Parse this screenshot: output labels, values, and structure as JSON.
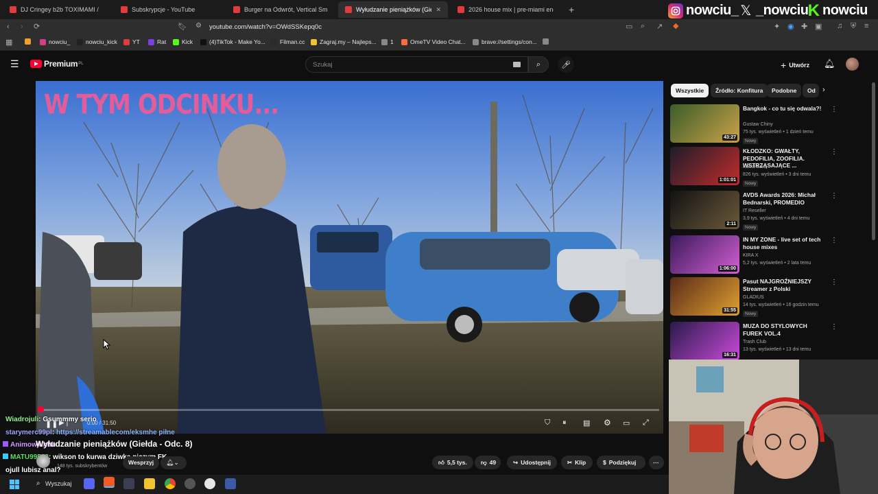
{
  "browser": {
    "tabs": [
      {
        "label": "DJ Cringey b2b TOXIMAMI // Sexpre",
        "color": "#e23b3b"
      },
      {
        "label": "Subskrypcje - YouTube",
        "color": "#e23b3b"
      },
      {
        "label": "Burger na Odwrót, Vertical Smash Bu",
        "color": "#e23b3b"
      },
      {
        "label": "Wyłudzanie pieniążków (Gie",
        "color": "#e23b3b",
        "active": true
      },
      {
        "label": "2026 house mix | pre-miami energy",
        "color": "#e23b3b"
      }
    ],
    "new_tab": "+",
    "url": "youtube.com/watch?v=OWdSSKepq0c",
    "bookmarks": [
      {
        "label": "",
        "color": "#f0a030"
      },
      {
        "label": "nowciu_",
        "color": "#d63a8a"
      },
      {
        "label": "nowciu_kick",
        "color": "#222222"
      },
      {
        "label": "YT",
        "color": "#e23b3b"
      },
      {
        "label": "Rat",
        "color": "#7b3fe4"
      },
      {
        "label": "Kick",
        "color": "#53fc18"
      },
      {
        "label": "(4)TikTok - Make Yo...",
        "color": "#111111"
      },
      {
        "label": "Filman.cc",
        "color": "#2a2a2a"
      },
      {
        "label": "Zagraj.my – Najleps...",
        "color": "#f2c230"
      },
      {
        "label": "1",
        "color": "#888888"
      },
      {
        "label": "OmeTV Video Chat...",
        "color": "#ff6a3d"
      },
      {
        "label": "brave://settings/con...",
        "color": "#888888"
      },
      {
        "label": "",
        "color": "#888888"
      }
    ]
  },
  "social": {
    "instagram": "nowciu_",
    "x": "_nowciu",
    "kick": "nowciu"
  },
  "youtube": {
    "logo_text": "Premium",
    "logo_sup": "PL",
    "search_placeholder": "Szukaj",
    "create_label": "Utwórz",
    "video": {
      "overlay_title": "W TYM ODCINKU...",
      "time": "0:00 / 31:50",
      "progress": 0.0
    },
    "title": "Wyłudzanie pieniążków (Giełda - Odc. 8)",
    "subscribers": "148 tys. subskrybentów",
    "support_label": "Wesprzyj",
    "actions": {
      "likes": "5,5 tys.",
      "dislikes": "49",
      "share": "Udostępnij",
      "clip": "Klip",
      "thanks": "Podziękuj"
    },
    "chips": [
      "Wszystkie",
      "Źródło: Konfitura",
      "Podobne",
      "Od"
    ],
    "recommendations": [
      {
        "title": "Bangkok - co tu się odwala?!",
        "channel": "Gustaw Chiny",
        "meta": "75 tys. wyświetleń • 1 dzień temu",
        "badge": "Nowy",
        "duration": "43:27",
        "color1": "#3b5d2a",
        "color2": "#c9a24a"
      },
      {
        "title": "KŁODZKO: GWAŁTY, PEDOFILIA, ZOOFILIA. WSTRZĄSAJĄCE ...",
        "channel": "Kanał Zero",
        "meta": "826 tys. wyświetleń • 3 dni temu",
        "badge": "Nowy",
        "duration": "1:01:01",
        "color1": "#1d1d2a",
        "color2": "#c22c2c"
      },
      {
        "title": "AVDS Awards 2026: Michał Bednarski, PROMEDIO",
        "channel": "IT Reseller",
        "meta": "3,9 tys. wyświetleń • 4 dni temu",
        "badge": "Nowy",
        "duration": "2:11",
        "color1": "#121212",
        "color2": "#6b5a3a"
      },
      {
        "title": "IN MY ZONE - live set of tech house mixes",
        "channel": "KIRA X",
        "meta": "5,2 tys. wyświetleń • 2 lata temu",
        "badge": "",
        "duration": "1:06:00",
        "color1": "#3a1a5a",
        "color2": "#d35fd3"
      },
      {
        "title": "Pasut NAJGROŹNIEJSZY Streamer z Polski",
        "channel": "GLADIUS",
        "meta": "14 tys. wyświetleń • 16 godzin temu",
        "badge": "Nowy",
        "duration": "31:55",
        "color1": "#5a2a1a",
        "color2": "#e0a030"
      },
      {
        "title": "MUZA DO STYLOWYCH FUREK VOL.4",
        "channel": "Trash Club",
        "meta": "13 tys. wyświetleń • 13 dni temu",
        "badge": "",
        "duration": "16:31",
        "color1": "#2a1a4a",
        "color2": "#c94ad9"
      }
    ]
  },
  "chat": [
    {
      "user": "Wiadrojuli",
      "sep": ": ",
      "text": "Gsummmy serio",
      "user_color": "#8ef08e",
      "text_color": "#ffffff"
    },
    {
      "user": "starymerc99pl",
      "sep": ": ",
      "text": "https://streamablecom/eksmhe piłne",
      "user_color": "#9fa8ff",
      "text_color": "#8ab4ff"
    },
    {
      "user": "Animowjuhhh",
      "sep": "",
      "text": "",
      "user_color": "#d19bff",
      "text_color": "#ffffff"
    },
    {
      "user": "MATU99558",
      "sep": ": ",
      "text": "wikson to kurwa dziwka niczym FK",
      "user_color": "#5fe05f",
      "text_color": "#ffffff"
    },
    {
      "user": "ojull",
      "sep": " ",
      "text": "lubisz anal?",
      "user_color": "#ffffff",
      "text_color": "#ffffff"
    }
  ],
  "taskbar": {
    "search_label": "Wyszukaj"
  }
}
